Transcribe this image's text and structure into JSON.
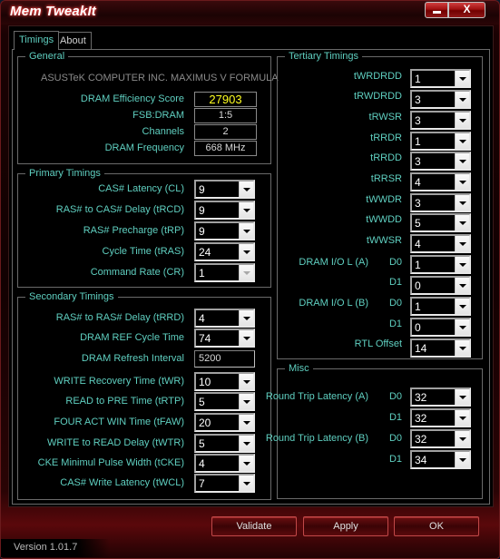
{
  "window": {
    "title": "Mem TweakIt",
    "minimize_label": "",
    "close_label": "X"
  },
  "tabs": [
    {
      "label": "Timings",
      "active": true
    },
    {
      "label": "About",
      "active": false
    }
  ],
  "general": {
    "legend": "General",
    "motherboard": "ASUSTeK COMPUTER INC. MAXIMUS V FORMULA",
    "fields": [
      {
        "label": "DRAM Efficiency Score",
        "value": "27903"
      },
      {
        "label": "FSB:DRAM",
        "value": "1:5"
      },
      {
        "label": "Channels",
        "value": "2"
      },
      {
        "label": "DRAM Frequency",
        "value": "668 MHz"
      }
    ]
  },
  "primary": {
    "legend": "Primary Timings",
    "fields": [
      {
        "label": "CAS# Latency (CL)",
        "value": "9"
      },
      {
        "label": "RAS# to CAS# Delay (tRCD)",
        "value": "9"
      },
      {
        "label": "RAS# Precharge (tRP)",
        "value": "9"
      },
      {
        "label": "Cycle Time (tRAS)",
        "value": "24"
      },
      {
        "label": "Command Rate (CR)",
        "value": "1",
        "disabled": true
      }
    ]
  },
  "secondary": {
    "legend": "Secondary Timings",
    "fields": [
      {
        "label": "RAS# to RAS# Delay (tRRD)",
        "value": "4"
      },
      {
        "label": "DRAM REF Cycle Time",
        "value": "74"
      },
      {
        "label": "DRAM Refresh Interval",
        "value": "5200",
        "type": "text"
      },
      {
        "label": "WRITE Recovery Time (tWR)",
        "value": "10"
      },
      {
        "label": "READ to PRE Time (tRTP)",
        "value": "5"
      },
      {
        "label": "FOUR ACT WIN Time (tFAW)",
        "value": "20"
      },
      {
        "label": "WRITE to READ Delay (tWTR)",
        "value": "5"
      },
      {
        "label": "CKE Minimul Pulse Width (tCKE)",
        "value": "4"
      },
      {
        "label": "CAS# Write Latency (tWCL)",
        "value": "7"
      }
    ]
  },
  "tertiary": {
    "legend": "Tertiary Timings",
    "fields": [
      {
        "label": "tWRDRDD",
        "value": "1"
      },
      {
        "label": "tRWDRDD",
        "value": "3"
      },
      {
        "label": "tRWSR",
        "value": "3"
      },
      {
        "label": "tRRDR",
        "value": "1"
      },
      {
        "label": "tRRDD",
        "value": "3"
      },
      {
        "label": "tRRSR",
        "value": "4"
      },
      {
        "label": "tWWDR",
        "value": "3"
      },
      {
        "label": "tWWDD",
        "value": "5"
      },
      {
        "label": "tWWSR",
        "value": "4"
      },
      {
        "label": "DRAM I/O L (A)",
        "sub": "D0",
        "value": "1"
      },
      {
        "label": "",
        "sub": "D1",
        "value": "0"
      },
      {
        "label": "DRAM I/O L (B)",
        "sub": "D0",
        "value": "1"
      },
      {
        "label": "",
        "sub": "D1",
        "value": "0"
      },
      {
        "label": "RTL Offset",
        "value": "14"
      }
    ]
  },
  "misc": {
    "legend": "Misc",
    "fields": [
      {
        "label": "Round Trip Latency (A)",
        "sub": "D0",
        "value": "32"
      },
      {
        "label": "",
        "sub": "D1",
        "value": "32"
      },
      {
        "label": "Round Trip Latency (B)",
        "sub": "D0",
        "value": "32"
      },
      {
        "label": "",
        "sub": "D1",
        "value": "34"
      }
    ]
  },
  "buttons": {
    "validate": "Validate",
    "apply": "Apply",
    "ok": "OK"
  },
  "version": "Version 1.01.7",
  "colors": {
    "label": "#5fcfc0",
    "score": "#ffff20",
    "frame": "#8a0a0c"
  }
}
